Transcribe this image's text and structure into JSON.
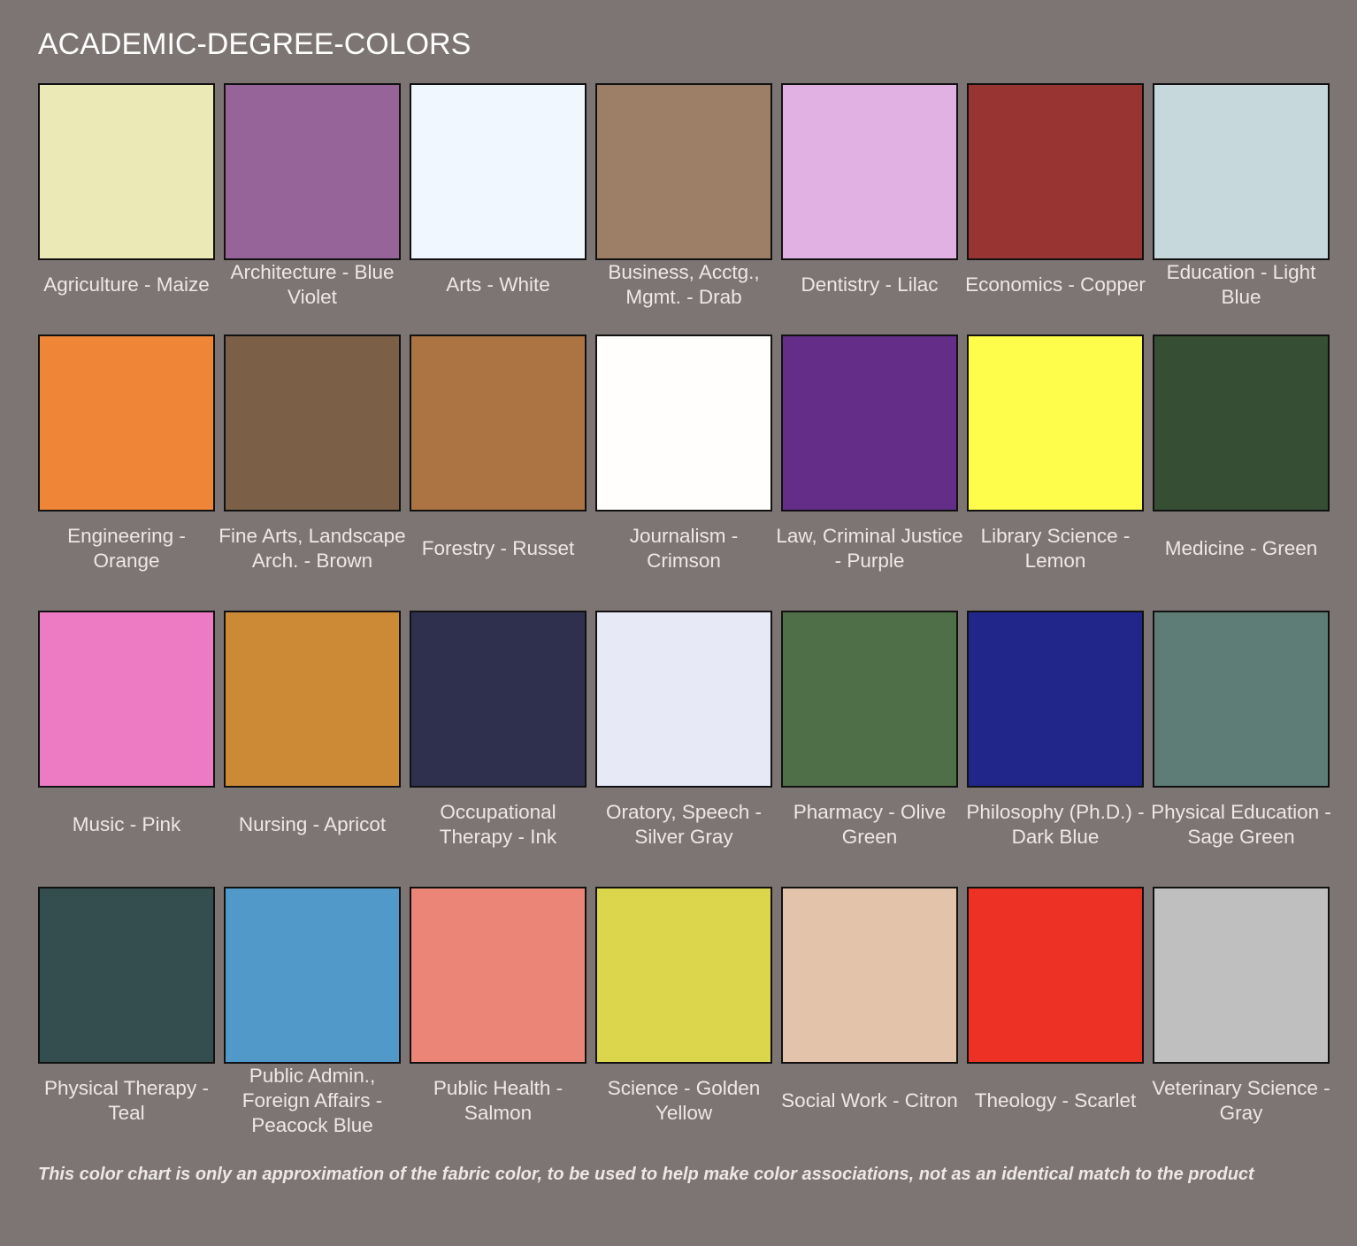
{
  "title": "ACADEMIC-DEGREE-COLORS",
  "disclaimer": "This color chart is only an approximation of the fabric color, to be used to help make color associations, not as an identical match to the product",
  "rows": [
    [
      {
        "label": "Agriculture - Maize",
        "color": "#ebe9b6"
      },
      {
        "label": "Architecture - Blue Violet",
        "color": "#966499"
      },
      {
        "label": "Arts - White",
        "color": "#f1f7ff"
      },
      {
        "label": "Business, Acctg., Mgmt. - Drab",
        "color": "#9d7f67"
      },
      {
        "label": "Dentistry - Lilac",
        "color": "#e2b1e4"
      },
      {
        "label": "Economics - Copper",
        "color": "#983432"
      },
      {
        "label": "Education - Light Blue",
        "color": "#c6d8db"
      }
    ],
    [
      {
        "label": "Engineering - Orange",
        "color": "#ee8537"
      },
      {
        "label": "Fine Arts, Landscape Arch. - Brown",
        "color": "#7c5f47"
      },
      {
        "label": "Forestry - Russet",
        "color": "#ac7442"
      },
      {
        "label": "Journalism - Crimson",
        "color": "#fffefd"
      },
      {
        "label": "Law, Criminal Justice - Purple",
        "color": "#632d88"
      },
      {
        "label": "Library Science - Lemon",
        "color": "#fffd4b"
      },
      {
        "label": "Medicine - Green",
        "color": "#364e33"
      }
    ],
    [
      {
        "label": "Music - Pink",
        "color": "#ed7bc3"
      },
      {
        "label": "Nursing - Apricot",
        "color": "#cc8a37"
      },
      {
        "label": "Occupational Therapy - Ink",
        "color": "#2e304d"
      },
      {
        "label": "Oratory, Speech - Silver Gray",
        "color": "#e7e9f7"
      },
      {
        "label": "Pharmacy - Olive Green",
        "color": "#4f6f48"
      },
      {
        "label": "Philosophy (Ph.D.) - Dark Blue",
        "color": "#21278a"
      },
      {
        "label": "Physical Education - Sage Green",
        "color": "#5d7d76"
      }
    ],
    [
      {
        "label": "Physical Therapy - Teal",
        "color": "#344d4f"
      },
      {
        "label": "Public Admin., Foreign Affairs - Peacock Blue",
        "color": "#5099c9"
      },
      {
        "label": "Public Health - Salmon",
        "color": "#eb8577"
      },
      {
        "label": "Science - Golden Yellow",
        "color": "#dcd64c"
      },
      {
        "label": "Social Work - Citron",
        "color": "#e3c3aa"
      },
      {
        "label": "Theology - Scarlet",
        "color": "#ed3225"
      },
      {
        "label": "Veterinary Science - Gray",
        "color": "#bfbfbf"
      }
    ]
  ]
}
